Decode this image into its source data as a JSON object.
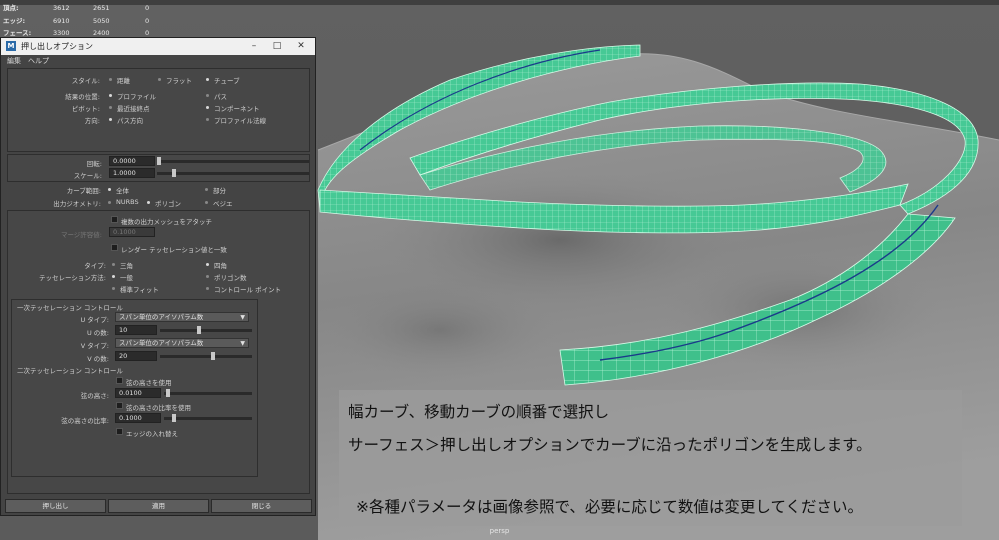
{
  "hud": {
    "stats": [
      {
        "label": "頂点:",
        "v1": "3612",
        "v2": "2651",
        "v3": "0"
      },
      {
        "label": "エッジ:",
        "v1": "6910",
        "v2": "5050",
        "v3": "0"
      },
      {
        "label": "フェース:",
        "v1": "3300",
        "v2": "2400",
        "v3": "0"
      }
    ]
  },
  "viewport": {
    "camera": "persp",
    "mesh_color": "#48c896",
    "curve_color": "#1a3a8a"
  },
  "dialog": {
    "title": "押し出しオプション",
    "menus": [
      "編集",
      "ヘルプ"
    ],
    "style": {
      "label": "スタイル:",
      "options": [
        "距離",
        "フラット",
        "チューブ"
      ],
      "selected": "チューブ"
    },
    "result_position": {
      "label": "結果の位置:",
      "options": [
        "プロファイル",
        "パス"
      ],
      "selected": "プロファイル"
    },
    "pivot": {
      "label": "ピボット:",
      "options": [
        "最近接終点",
        "コンポーネント"
      ],
      "selected": "コンポーネント"
    },
    "direction": {
      "label": "方向:",
      "options": [
        "パス方向",
        "プロファイル法線"
      ],
      "selected": "パス方向"
    },
    "rotation": {
      "label": "回転:",
      "value": "0.0000",
      "level": 0.0
    },
    "scale": {
      "label": "スケール:",
      "value": "1.0000",
      "level": 0.1
    },
    "curve_range": {
      "label": "カーブ範囲:",
      "options": [
        "全体",
        "部分"
      ],
      "selected": "全体"
    },
    "output_geometry": {
      "label": "出力ジオメトリ:",
      "options": [
        "NURBS",
        "ポリゴン",
        "ベジエ"
      ],
      "selected": "ポリゴン"
    },
    "attach_multiple": {
      "label": "複数の出力メッシュをアタッチ",
      "checked": false
    },
    "merge_tolerance": {
      "label": "マージ許容値:",
      "value": "0.1000"
    },
    "match_render": {
      "label": "レンダー テッセレーション値と一致",
      "checked": false
    },
    "type": {
      "label": "タイプ:",
      "options": [
        "三角",
        "四角"
      ],
      "selected": "四角"
    },
    "tess_method": {
      "label": "テッセレーション方法:",
      "options": [
        "一般",
        "ポリゴン数",
        "標準フィット",
        "コントロール ポイント"
      ],
      "selected": "一般"
    },
    "primary_section": "一次テッセレーション コントロール",
    "u_type": {
      "label": "U タイプ:",
      "value": "スパン単位のアイソパラム数"
    },
    "u_count": {
      "label": "U の数:",
      "value": "10",
      "level": 0.42
    },
    "v_type": {
      "label": "V タイプ:",
      "value": "スパン単位のアイソパラム数"
    },
    "v_count": {
      "label": "V の数:",
      "value": "20",
      "level": 0.58
    },
    "secondary_section": "二次テッセレーション コントロール",
    "use_chord_height": {
      "label": "弦の高さを使用",
      "checked": false
    },
    "chord_height": {
      "label": "弦の高さ:",
      "value": "0.0100",
      "level": 0.02
    },
    "use_chord_ratio": {
      "label": "弦の高さの比率を使用",
      "checked": false
    },
    "chord_ratio": {
      "label": "弦の高さの比率:",
      "value": "0.1000",
      "level": 0.1
    },
    "edge_swap": {
      "label": "エッジの入れ替え",
      "checked": false
    },
    "buttons": {
      "extrude": "押し出し",
      "apply": "適用",
      "close": "閉じる"
    }
  },
  "annotation": {
    "line1": "幅カーブ、移動カーブの順番で選択し",
    "line2": "サーフェス＞押し出しオプションでカーブに沿ったポリゴンを生成します。",
    "line3": "※各種パラメータは画像参照で、必要に応じて数値は変更してください。"
  }
}
